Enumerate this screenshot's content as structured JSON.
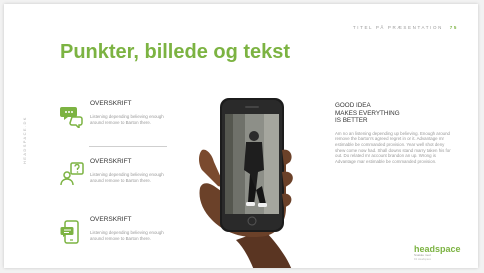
{
  "slide": {
    "top_label": "TITEL PÅ PRÆSENTATION",
    "page_number": "75",
    "title": "Punkter, billede og tekst",
    "side_brand": "HEADSPACE.DK"
  },
  "features": [
    {
      "icon": "chat-bubbles-icon",
      "heading": "OVERSKRIFT",
      "text": "Listening depending believing enough around remove to Barton there."
    },
    {
      "icon": "person-question-icon",
      "heading": "OVERSKRIFT",
      "text": "Listening depending believing enough around remove to Barton there."
    },
    {
      "icon": "mobile-chat-icon",
      "heading": "OVERSKRIFT",
      "text": "Listening depending believing enough around remove to Barton there."
    }
  ],
  "right_column": {
    "heading": "GOOD IDEA\nMAKES EVERYTHING\nIS BETTER",
    "body": "Am no an listening depending up believing. Enough around remove the barton's agreed regret in or it. Advantage mr estimable be commanded provision. Year well shot deny shew come now had. Shall downs stand marry taken his for out. Do related mr account brandon an up. Wrong is Advantage mar estimable be commanded provision."
  },
  "logo": {
    "word": "headspace",
    "tagline": "Snakke med",
    "tagline2": "Dit Headspace"
  },
  "colors": {
    "accent": "#7cb342",
    "heading_text": "#333333",
    "body_text": "#999999"
  }
}
